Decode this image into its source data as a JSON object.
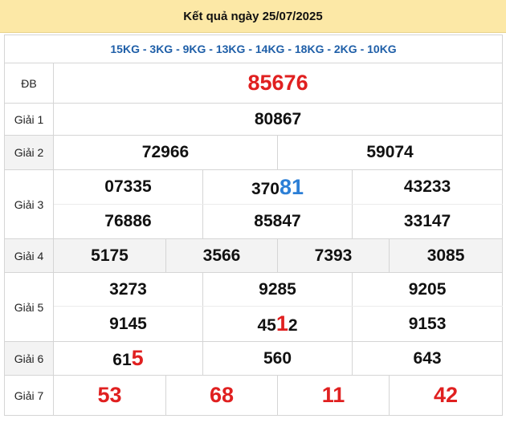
{
  "header": {
    "title": "Kết quả ngày 25/07/2025"
  },
  "codes": "15KG - 3KG - 9KG - 13KG - 14KG - 18KG - 2KG - 10KG",
  "labels": {
    "db": "ĐB",
    "g1": "Giải 1",
    "g2": "Giải 2",
    "g3": "Giải 3",
    "g4": "Giải 4",
    "g5": "Giải 5",
    "g6": "Giải 6",
    "g7": "Giải 7"
  },
  "db": "85676",
  "g1": "80867",
  "g2": [
    "72966",
    "59074"
  ],
  "g3": {
    "row1": [
      "07335",
      {
        "prefix": "370",
        "highlight": "81",
        "suffix": ""
      },
      "43233"
    ],
    "row2": [
      "76886",
      "85847",
      "33147"
    ]
  },
  "g4": [
    "5175",
    "3566",
    "7393",
    "3085"
  ],
  "g5": {
    "row1": [
      "3273",
      "9285",
      "9205"
    ],
    "row2": [
      "9145",
      {
        "prefix": "45",
        "highlight": "1",
        "suffix": "2"
      },
      "9153"
    ]
  },
  "g6": [
    {
      "prefix": "61",
      "highlight": "5",
      "suffix": ""
    },
    "560",
    "643"
  ],
  "g7": [
    "53",
    "68",
    "11",
    "42"
  ],
  "colors": {
    "header_bg": "#fce8a6",
    "code_text": "#1f5fa8",
    "highlight_red": "#e02020",
    "highlight_blue": "#2c7fd6",
    "alt_row": "#f3f3f3"
  }
}
